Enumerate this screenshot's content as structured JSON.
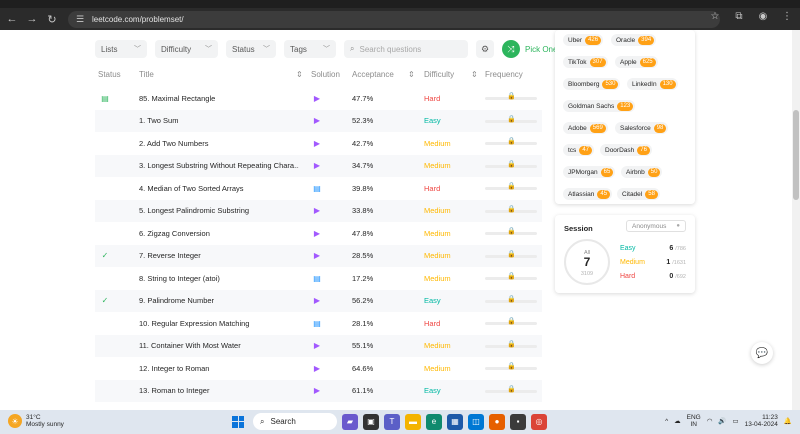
{
  "browser": {
    "url": "leetcode.com/problemset/"
  },
  "filters": {
    "lists": "Lists",
    "difficulty": "Difficulty",
    "status": "Status",
    "tags": "Tags",
    "search_placeholder": "Search questions",
    "pick_one": "Pick One"
  },
  "table": {
    "headers": {
      "status": "Status",
      "title": "Title",
      "solution": "Solution",
      "acceptance": "Acceptance",
      "difficulty": "Difficulty",
      "frequency": "Frequency"
    },
    "rows": [
      {
        "status": "daily",
        "title": "85. Maximal Rectangle",
        "solution": "video",
        "acceptance": "47.7%",
        "difficulty": "Hard"
      },
      {
        "status": "",
        "title": "1. Two Sum",
        "solution": "video",
        "acceptance": "52.3%",
        "difficulty": "Easy"
      },
      {
        "status": "",
        "title": "2. Add Two Numbers",
        "solution": "video",
        "acceptance": "42.7%",
        "difficulty": "Medium"
      },
      {
        "status": "",
        "title": "3. Longest Substring Without Repeating Chara...",
        "solution": "video",
        "acceptance": "34.7%",
        "difficulty": "Medium"
      },
      {
        "status": "",
        "title": "4. Median of Two Sorted Arrays",
        "solution": "doc",
        "acceptance": "39.8%",
        "difficulty": "Hard"
      },
      {
        "status": "",
        "title": "5. Longest Palindromic Substring",
        "solution": "video",
        "acceptance": "33.8%",
        "difficulty": "Medium"
      },
      {
        "status": "",
        "title": "6. Zigzag Conversion",
        "solution": "video",
        "acceptance": "47.8%",
        "difficulty": "Medium"
      },
      {
        "status": "solved",
        "title": "7. Reverse Integer",
        "solution": "video",
        "acceptance": "28.5%",
        "difficulty": "Medium"
      },
      {
        "status": "",
        "title": "8. String to Integer (atoi)",
        "solution": "doc",
        "acceptance": "17.2%",
        "difficulty": "Medium"
      },
      {
        "status": "solved",
        "title": "9. Palindrome Number",
        "solution": "video",
        "acceptance": "56.2%",
        "difficulty": "Easy"
      },
      {
        "status": "",
        "title": "10. Regular Expression Matching",
        "solution": "doc",
        "acceptance": "28.1%",
        "difficulty": "Hard"
      },
      {
        "status": "",
        "title": "11. Container With Most Water",
        "solution": "video",
        "acceptance": "55.1%",
        "difficulty": "Medium"
      },
      {
        "status": "",
        "title": "12. Integer to Roman",
        "solution": "video",
        "acceptance": "64.6%",
        "difficulty": "Medium"
      },
      {
        "status": "",
        "title": "13. Roman to Integer",
        "solution": "video",
        "acceptance": "61.1%",
        "difficulty": "Easy"
      }
    ]
  },
  "companies": [
    {
      "name": "Uber",
      "count": "426"
    },
    {
      "name": "Oracle",
      "count": "394"
    },
    {
      "name": "TikTok",
      "count": "307"
    },
    {
      "name": "Apple",
      "count": "625"
    },
    {
      "name": "Bloomberg",
      "count": "530"
    },
    {
      "name": "LinkedIn",
      "count": "130"
    },
    {
      "name": "Goldman Sachs",
      "count": "123"
    },
    {
      "name": "Adobe",
      "count": "569"
    },
    {
      "name": "Salesforce",
      "count": "98"
    },
    {
      "name": "tcs",
      "count": "47"
    },
    {
      "name": "DoorDash",
      "count": "76"
    },
    {
      "name": "JPMorgan",
      "count": "65"
    },
    {
      "name": "Airbnb",
      "count": "50"
    },
    {
      "name": "Atlassian",
      "count": "45"
    },
    {
      "name": "Citadel",
      "count": "58"
    }
  ],
  "session": {
    "label": "Session",
    "selector": "Anonymous",
    "ring_label": "All",
    "solved": "7",
    "total": "3109",
    "easy": {
      "label": "Easy",
      "solved": "6",
      "total": "/786"
    },
    "medium": {
      "label": "Medium",
      "solved": "1",
      "total": "/1631"
    },
    "hard": {
      "label": "Hard",
      "solved": "0",
      "total": "/692"
    }
  },
  "colors": {
    "easy": "#00b8a3",
    "medium": "#ffb800",
    "hard": "#ef4743",
    "accent": "#ffa116",
    "solved": "#2db55d"
  },
  "taskbar": {
    "weather_temp": "31°C",
    "weather_desc": "Mostly sunny",
    "search": "Search",
    "lang_top": "ENG",
    "lang_bottom": "IN",
    "time": "11:23",
    "date": "13-04-2024"
  }
}
